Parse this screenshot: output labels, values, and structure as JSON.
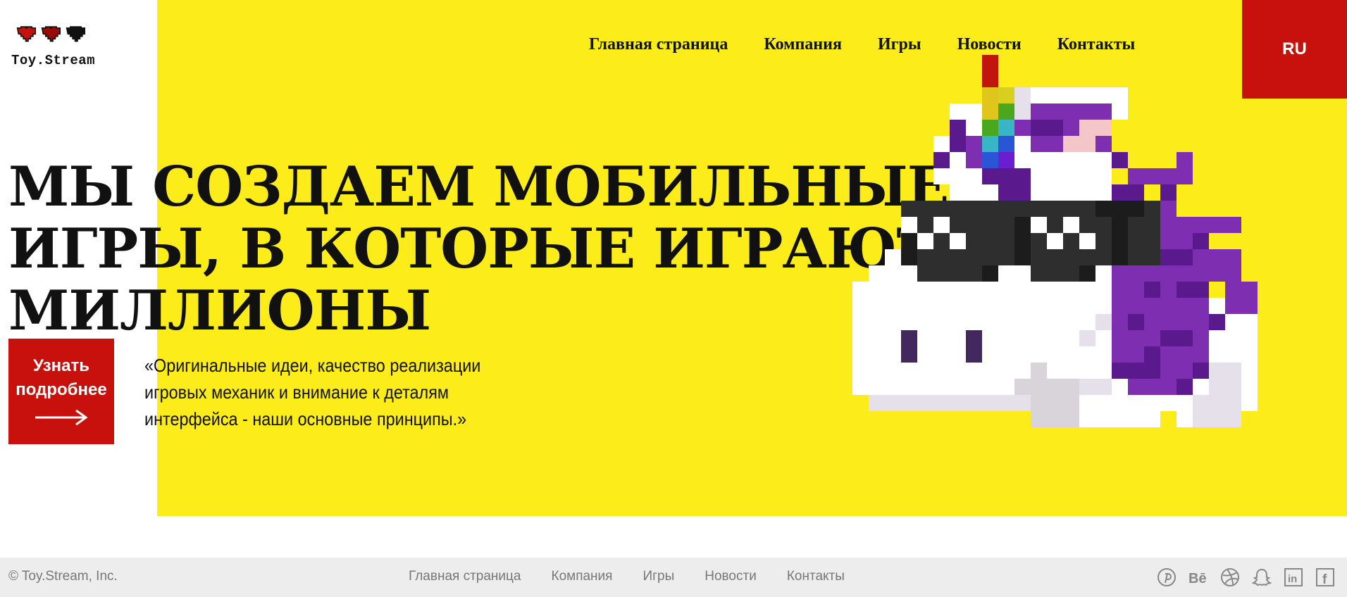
{
  "logo": {
    "text": "Toy.Stream"
  },
  "nav": [
    {
      "label": "Главная страница"
    },
    {
      "label": "Компания"
    },
    {
      "label": "Игры"
    },
    {
      "label": "Новости"
    },
    {
      "label": "Контакты"
    }
  ],
  "lang": {
    "label": "RU"
  },
  "hero": {
    "headline": [
      "МЫ СОЗДАЕМ МОБИЛЬНЫЕ",
      "ИГРЫ, В КОТОРЫЕ ИГРАЮТ",
      "МИЛЛИОНЫ"
    ],
    "cta_label_line1": "Узнать",
    "cta_label_line2": "подробнее",
    "quote": "«Оригинальные идеи, качество реализации игровых механик и внимание к деталям интерфейса - наши основные принципы.»"
  },
  "footer": {
    "copyright": "© Toy.Stream, Inc.",
    "nav": [
      {
        "label": "Главная страница"
      },
      {
        "label": "Компания"
      },
      {
        "label": "Игры"
      },
      {
        "label": "Новости"
      },
      {
        "label": "Контакты"
      }
    ],
    "social": [
      "pinterest-icon",
      "behance-icon",
      "dribbble-icon",
      "snapchat-icon",
      "linkedin-icon",
      "facebook-icon"
    ]
  },
  "colors": {
    "accent": "#c8100c",
    "hero_bg": "#fcec1a",
    "footer_bg": "#ededed"
  }
}
